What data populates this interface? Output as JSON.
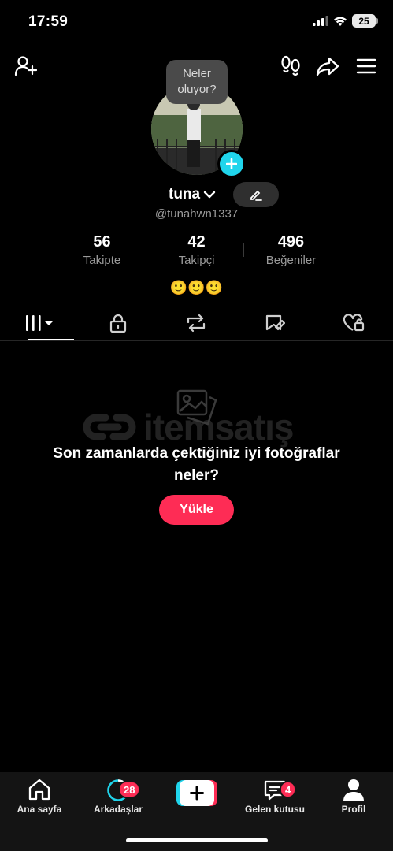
{
  "status": {
    "time": "17:59",
    "battery": "25"
  },
  "profile": {
    "story_bubble": "Neler oluyor?",
    "username": "tuna",
    "handle": "@tunahwn1337",
    "bio": "🙂🙂🙂",
    "stats": [
      {
        "value": "56",
        "label": "Takipte"
      },
      {
        "value": "42",
        "label": "Takipçi"
      },
      {
        "value": "496",
        "label": "Beğeniler"
      }
    ]
  },
  "tabs": [
    {
      "icon": "grid-videos-icon",
      "active": true
    },
    {
      "icon": "lock-icon",
      "active": false
    },
    {
      "icon": "repost-icon",
      "active": false
    },
    {
      "icon": "bookmark-tag-icon",
      "active": false
    },
    {
      "icon": "liked-heart-icon",
      "active": false
    }
  ],
  "empty_state": {
    "title": "Son zamanlarda çektiğiniz iyi fotoğraflar neler?",
    "button": "Yükle"
  },
  "watermark": {
    "brand": "itemsatış"
  },
  "nav": {
    "home": "Ana sayfa",
    "friends": "Arkadaşlar",
    "friends_badge": "28",
    "inbox": "Gelen kutusu",
    "inbox_badge": "4",
    "profile": "Profil"
  },
  "colors": {
    "accent": "#fe2c55",
    "cyan": "#20d5ec",
    "background": "#000000"
  }
}
